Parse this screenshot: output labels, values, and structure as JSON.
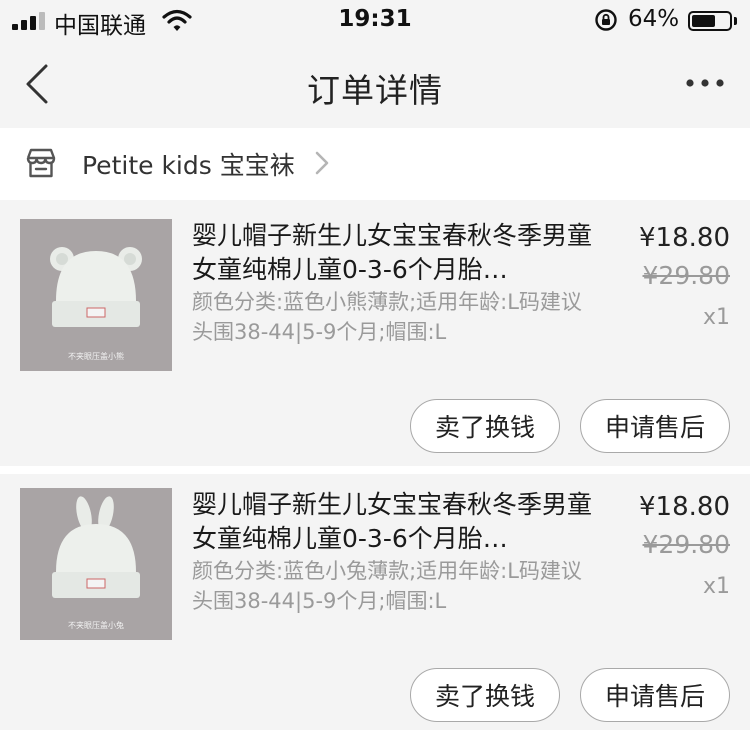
{
  "status_bar": {
    "carrier": "中国联通",
    "time": "19:31",
    "battery_percent": "64%",
    "battery_level": 0.64,
    "icons": [
      "signal-icon",
      "wifi-icon",
      "rotation-lock-icon",
      "battery-icon"
    ]
  },
  "nav": {
    "title": "订单详情",
    "icons": [
      "back-icon",
      "more-icon"
    ]
  },
  "shop": {
    "name": "Petite kids 宝宝袜",
    "icons": [
      "store-icon",
      "chevron-right-icon"
    ]
  },
  "items": [
    {
      "title": "婴儿帽子新生儿女宝宝春秋冬季男童女童纯棉儿童0-3-6个月胎…",
      "sku": "颜色分类:蓝色小熊薄款;适用年龄:L码建议头围38-44|5-9个月;帽围:L",
      "price": "¥18.80",
      "original_price": "¥29.80",
      "quantity": "x1",
      "buttons": {
        "sell": "卖了换钱",
        "after_sale": "申请售后"
      },
      "image_caption": "不夹眼压盖小熊"
    },
    {
      "title": "婴儿帽子新生儿女宝宝春秋冬季男童女童纯棉儿童0-3-6个月胎…",
      "sku": "颜色分类:蓝色小兔薄款;适用年龄:L码建议头围38-44|5-9个月;帽围:L",
      "price": "¥18.80",
      "original_price": "¥29.80",
      "quantity": "x1",
      "buttons": {
        "sell": "卖了换钱",
        "after_sale": "申请售后"
      },
      "image_caption": "不夹眼压盖小兔"
    }
  ],
  "colors": {
    "background": "#f4f4f4",
    "card": "#ffffff",
    "secondary_text": "#9a9a9a",
    "button_border": "#a9a9a9"
  }
}
